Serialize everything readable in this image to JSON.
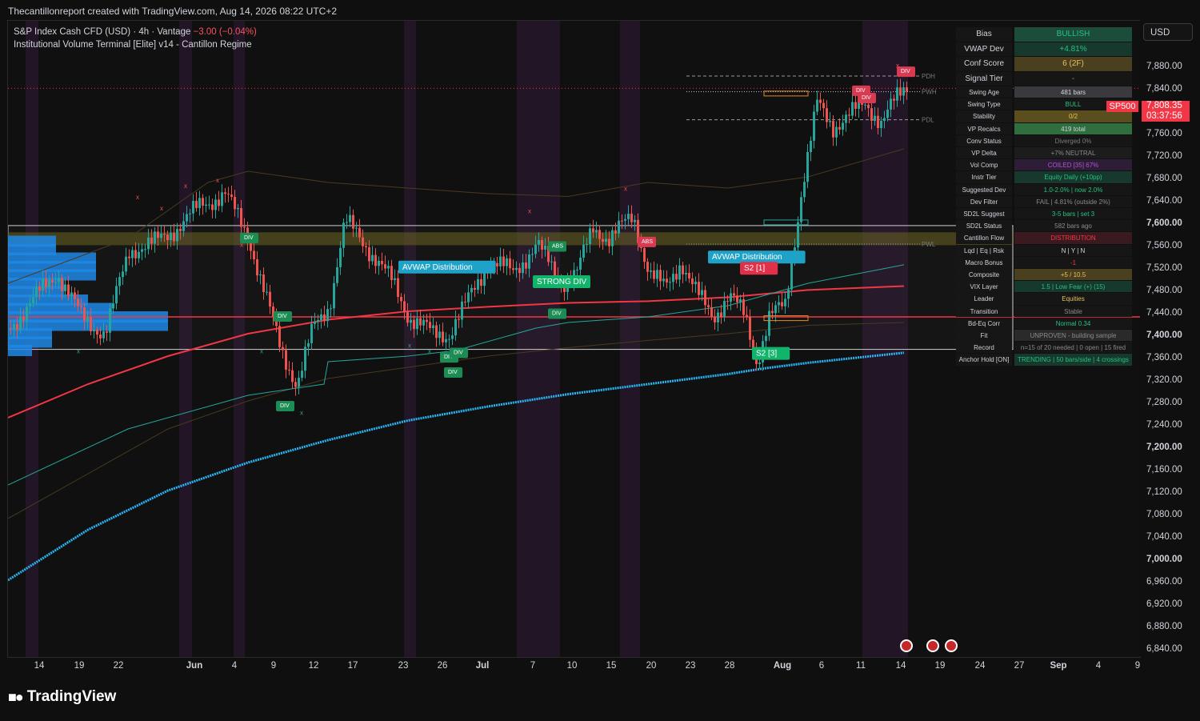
{
  "header": {
    "attribution": "Thecantillonreport created with TradingView.com, Aug 14, 2026 08:22 UTC+2"
  },
  "legend": {
    "symbol_line_prefix": "S&P Index Cash CFD (USD) · 4h · Vantage",
    "change": "−3.00 (−0.04%)",
    "indicator": "Institutional Volume Terminal [Elite] v14 - Cantillon Regime"
  },
  "price_axis": {
    "currency_button": "USD",
    "ticks": [
      "7,880.00",
      "7,840.00",
      "7,800.00",
      "7,760.00",
      "7,720.00",
      "7,680.00",
      "7,640.00",
      "7,600.00",
      "7,560.00",
      "7,520.00",
      "7,480.00",
      "7,440.00",
      "7,400.00",
      "7,360.00",
      "7,320.00",
      "7,280.00",
      "7,240.00",
      "7,200.00",
      "7,160.00",
      "7,120.00",
      "7,080.00",
      "7,040.00",
      "7,000.00",
      "6,960.00",
      "6,920.00",
      "6,880.00",
      "6,840.00"
    ],
    "bold_ticks": [
      "7,600.00",
      "7,400.00",
      "7,200.00",
      "7,000.00"
    ],
    "last_price": "7,808.35",
    "countdown": "03:37:56",
    "symbol_tag": "SP500"
  },
  "time_axis": {
    "ticks": [
      "14",
      "19",
      "22",
      "Jun",
      "4",
      "9",
      "12",
      "17",
      "23",
      "26",
      "Jul",
      "7",
      "10",
      "15",
      "20",
      "23",
      "28",
      "Aug",
      "6",
      "11",
      "14",
      "19",
      "24",
      "27",
      "Sep",
      "4",
      "9"
    ],
    "bold_ticks": [
      "Jun",
      "Jul",
      "Aug",
      "Sep"
    ]
  },
  "brand": {
    "name": "TradingView"
  },
  "panel": {
    "rows": [
      {
        "key": "Bias",
        "value": "BULLISH",
        "fg": "#26c281",
        "bg": "#1b4d3a",
        "big": true
      },
      {
        "key": "VWAP Dev",
        "value": "+4.81%",
        "fg": "#26c281",
        "bg": "#17382c",
        "big": true
      },
      {
        "key": "Conf Score",
        "value": "6 (2F)",
        "fg": "#e6c15a",
        "bg": "#4a4020",
        "big": true
      },
      {
        "key": "Signal Tier",
        "value": "-",
        "fg": "#8a8a8a",
        "bg": "#161616",
        "big": true
      },
      {
        "key": "Swing Age",
        "value": "481 bars",
        "fg": "#d1d4dc",
        "bg": "#3a3a3e"
      },
      {
        "key": "Swing Type",
        "value": "BULL",
        "fg": "#26c281",
        "bg": "#161616"
      },
      {
        "key": "Stability",
        "value": "0/2",
        "fg": "#e6c15a",
        "bg": "#5a4e1e"
      },
      {
        "key": "VP Recalcs",
        "value": "419 total",
        "fg": "#d1d4dc",
        "bg": "#2f6e3f"
      },
      {
        "key": "Conv Status",
        "value": "Diverged 0%",
        "fg": "#7a7a7a",
        "bg": "#161616"
      },
      {
        "key": "VP Delta",
        "value": "+7% NEUTRAL",
        "fg": "#8a8a8a",
        "bg": "#1c1c1c"
      },
      {
        "key": "Vol Comp",
        "value": "COILED [35] 67%",
        "fg": "#b055d8",
        "bg": "#2e1d36"
      },
      {
        "key": "Instr Tier",
        "value": "Equity Daily (+10pp)",
        "fg": "#26c281",
        "bg": "#17382c"
      },
      {
        "key": "Suggested Dev",
        "value": "1.0-2.0% | now 2.0%",
        "fg": "#26c281",
        "bg": "#161616"
      },
      {
        "key": "Dev Filter",
        "value": "FAIL | 4.81% (outside 2%)",
        "fg": "#8a8a8a",
        "bg": "#161616"
      },
      {
        "key": "SD2L Suggest",
        "value": "3-5 bars | set 3",
        "fg": "#26c281",
        "bg": "#161616"
      },
      {
        "key": "SD2L Status",
        "value": "582 bars ago",
        "fg": "#8a8a8a",
        "bg": "#161616"
      },
      {
        "key": "Cantillon Flow",
        "value": "DISTRIBUTION",
        "fg": "#f23645",
        "bg": "#3a1a1e"
      },
      {
        "key": "Lqd | Eq | Rsk",
        "value": "N | Y | N",
        "fg": "#d1d4dc",
        "bg": "#161616"
      },
      {
        "key": "Macro Bonus",
        "value": "-1",
        "fg": "#f23645",
        "bg": "#161616"
      },
      {
        "key": "Composite",
        "value": "+5 / 10.5",
        "fg": "#e6c15a",
        "bg": "#4a4020"
      },
      {
        "key": "VIX Layer",
        "value": "1.5 | Low Fear (+) (15)",
        "fg": "#26c281",
        "bg": "#17382c"
      },
      {
        "key": "Leader",
        "value": "Equities",
        "fg": "#e6c15a",
        "bg": "#161616"
      },
      {
        "key": "Transition",
        "value": "Stable",
        "fg": "#8a8a8a",
        "bg": "#161616"
      },
      {
        "key": "Bd-Eq Corr",
        "value": "Normal 0.34",
        "fg": "#26c281",
        "bg": "#161616"
      },
      {
        "key": "Fit",
        "value": "UNPROVEN - building sample",
        "fg": "#8a8a8a",
        "bg": "#2a2a2a"
      },
      {
        "key": "Record",
        "value": "n=15 of 20 needed | 0 open | 15 fired",
        "fg": "#8a8a8a",
        "bg": "#161616"
      },
      {
        "key": "Anchor Hold [ON]",
        "value": "TRENDING | 50 bars/side | 4 crossings",
        "fg": "#26c281",
        "bg": "#17382c"
      }
    ]
  },
  "level_labels": {
    "pdh": "PDH",
    "pwh": "PWH",
    "pdl": "PDL",
    "pwl": "PWL"
  },
  "annotations": {
    "avwap1": "AVWAP Distribution",
    "avwap2": "AVWAP Distribution",
    "strong_div": "STRONG DIV",
    "s2_1": "S2 [1]",
    "s2_3": "S2 [3]",
    "div": "DIV",
    "abs": "ABS",
    "cross": "x"
  },
  "colors": {
    "bull": "#26a69a",
    "bear": "#ef5350",
    "avwap_blue": "#29b6f6",
    "red_ma": "#f23645",
    "yellow_zone": "#6b6420",
    "volume_profile": "#1e88e5",
    "session_shade": "#221526"
  }
}
